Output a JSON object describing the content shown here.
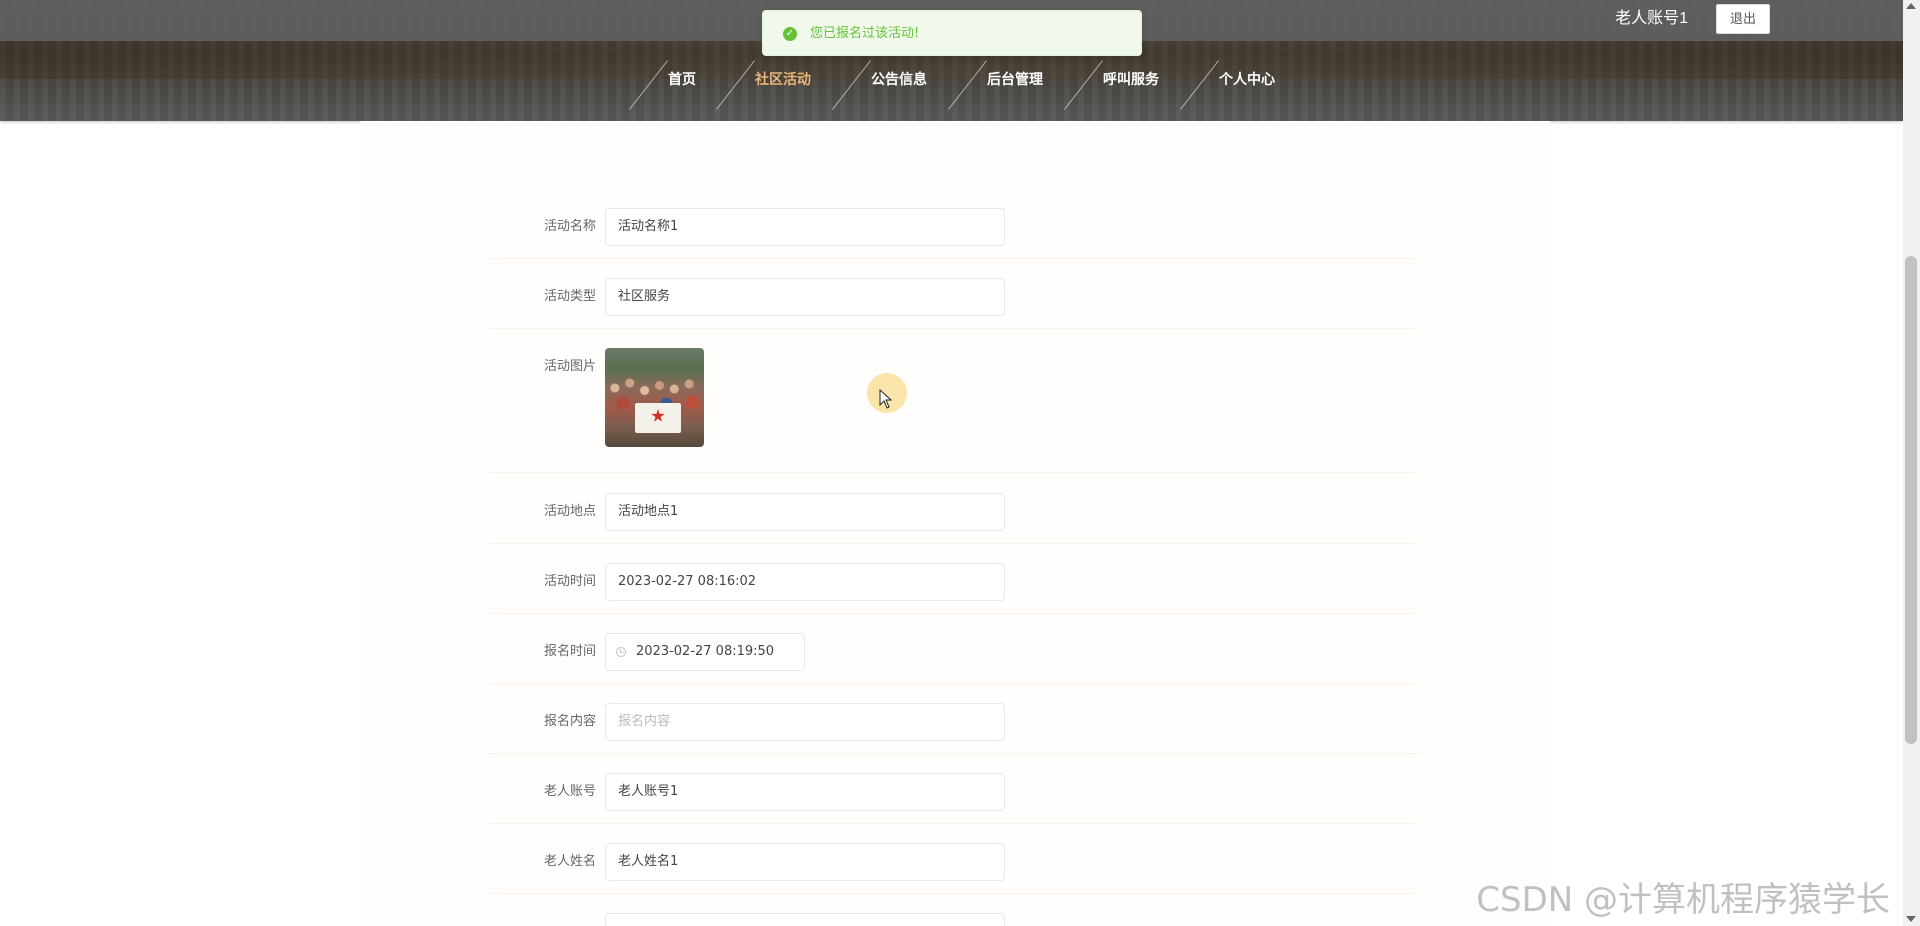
{
  "header": {
    "user_name": "老人账号1",
    "logout_label": "退出",
    "nav": [
      {
        "label": "首页",
        "active": false
      },
      {
        "label": "社区活动",
        "active": true
      },
      {
        "label": "公告信息",
        "active": false
      },
      {
        "label": "后台管理",
        "active": false
      },
      {
        "label": "呼叫服务",
        "active": false
      },
      {
        "label": "个人中心",
        "active": false
      }
    ]
  },
  "toast": {
    "icon": "check-circle-icon",
    "message": "您已报名过该活动!",
    "color": "#67c23a"
  },
  "form": {
    "activity_name": {
      "label": "活动名称",
      "value": "活动名称1"
    },
    "activity_type": {
      "label": "活动类型",
      "value": "社区服务"
    },
    "activity_image": {
      "label": "活动图片"
    },
    "activity_location": {
      "label": "活动地点",
      "value": "活动地点1"
    },
    "activity_time": {
      "label": "活动时间",
      "value": "2023-02-27 08:16:02"
    },
    "signup_time": {
      "label": "报名时间",
      "value": "2023-02-27 08:19:50"
    },
    "signup_content": {
      "label": "报名内容",
      "placeholder": "报名内容"
    },
    "elder_account": {
      "label": "老人账号",
      "value": "老人账号1"
    },
    "elder_name": {
      "label": "老人姓名",
      "value": "老人姓名1"
    }
  },
  "watermark": "CSDN @计算机程序猿学长",
  "colors": {
    "accent_nav_active": "#e8b67a",
    "success": "#67c23a"
  }
}
